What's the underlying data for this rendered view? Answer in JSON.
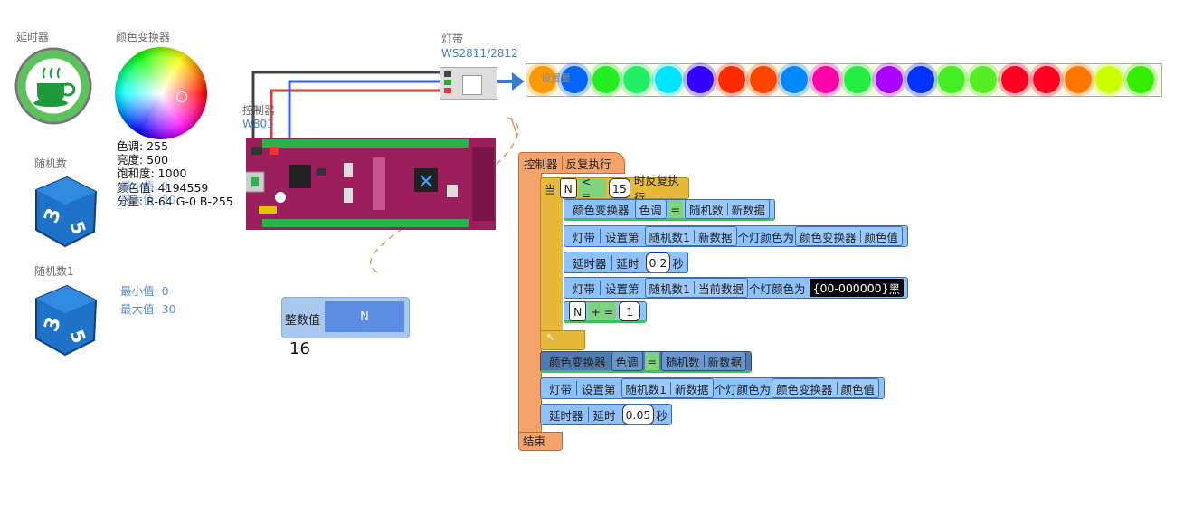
{
  "delay": {
    "label": "延时器"
  },
  "color_picker": {
    "label": "颜色变换器",
    "hue": "色调: 255",
    "brightness": "亮度: 500",
    "saturation": "饱和度: 1000",
    "color_value": "颜色值: 4194559",
    "components": "分量: R-64 G-0 B-255"
  },
  "random1": {
    "label": "随机数",
    "overlap_a": "最小值: 0",
    "overlap_b": "最大值: 30"
  },
  "random2": {
    "label": "随机数1",
    "min": "最小值: 0",
    "max": "最大值: 30"
  },
  "controller": {
    "label": "控制器",
    "model": "W801"
  },
  "strip": {
    "label": "灯带",
    "model": "WS2811/2812",
    "overlay": "设置量",
    "led_colors": [
      "#ff9900",
      "#0066ff",
      "#22ee22",
      "#22ee66",
      "#00e5ff",
      "#3300ff",
      "#ff2a00",
      "#ff4400",
      "#0088ff",
      "#ff00aa",
      "#22ee44",
      "#aa00ff",
      "#0033ff",
      "#44ee22",
      "#55ee22",
      "#ff0022",
      "#ff0022",
      "#ff7700",
      "#ccff00",
      "#33ee00"
    ]
  },
  "variable": {
    "label": "整数值",
    "name": "N",
    "value": "16"
  },
  "code": {
    "header": [
      "控制器",
      "反复执行"
    ],
    "while": {
      "kw": "当",
      "var": "N",
      "op": "< =",
      "limit": "15",
      "tail": "时反复执行"
    },
    "l1": {
      "obj": "颜色变换器",
      "prop": "色调",
      "eq": "=",
      "robj": "随机数",
      "rprop": "新数据"
    },
    "l2": {
      "obj": "灯带",
      "act": "设置第",
      "robj": "随机数1",
      "rprop": "新数据",
      "mid": "个灯颜色为",
      "cobj": "颜色变换器",
      "cprop": "颜色值"
    },
    "l3": {
      "obj": "延时器",
      "act": "延时",
      "val": "0.2",
      "unit": "秒"
    },
    "l4": {
      "obj": "灯带",
      "act": "设置第",
      "robj": "随机数1",
      "rprop": "当前数据",
      "mid": "个灯颜色为",
      "color": "{00-000000}",
      "cname": "黑"
    },
    "l5": {
      "var": "N",
      "op": "+ =",
      "val": "1"
    },
    "loop_end": "↖",
    "l6": {
      "obj": "颜色变换器",
      "prop": "色调",
      "eq": "=",
      "robj": "随机数",
      "rprop": "新数据"
    },
    "l7": {
      "obj": "灯带",
      "act": "设置第",
      "robj": "随机数1",
      "rprop": "新数据",
      "mid": "个灯颜色为",
      "cobj": "颜色变换器",
      "cprop": "颜色值"
    },
    "l8": {
      "obj": "延时器",
      "act": "延时",
      "val": "0.05",
      "unit": "秒"
    },
    "end": "结束"
  }
}
